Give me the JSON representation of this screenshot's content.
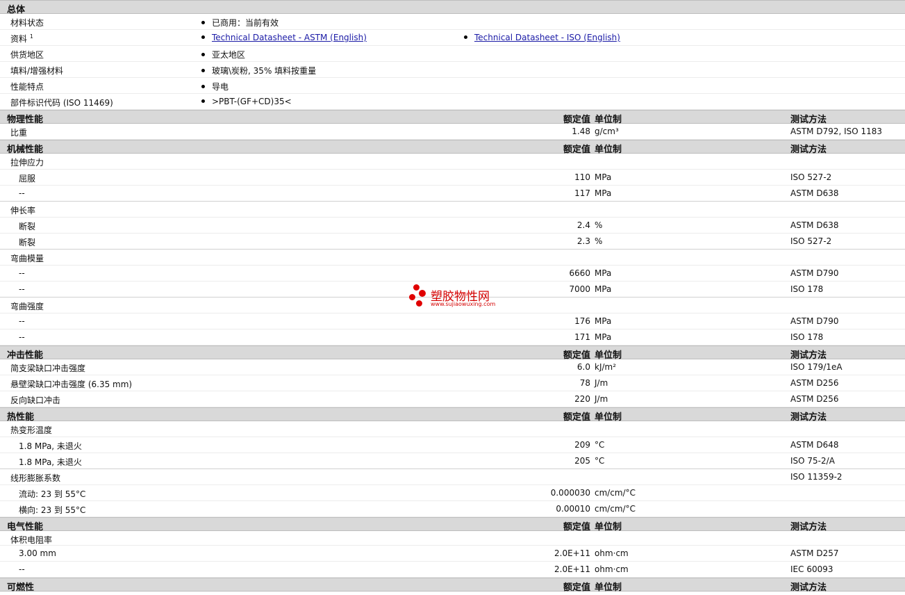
{
  "general": {
    "title": "总体",
    "rows": [
      {
        "label": "材料状态",
        "value": "已商用：当前有效"
      },
      {
        "label": "资料",
        "sup": "1",
        "link1": "Technical Datasheet - ASTM (English)",
        "link2": "Technical Datasheet - ISO (English)"
      },
      {
        "label": "供货地区",
        "value": "亚太地区"
      },
      {
        "label": "填料/增强材料",
        "value": "玻璃\\炭粉, 35% 填料按重量"
      },
      {
        "label": "性能特点",
        "value": "导电"
      },
      {
        "label": "部件标识代码 (ISO 11469)",
        "value": ">PBT-(GF+CD)35<"
      }
    ]
  },
  "headers": {
    "nominal": "额定值",
    "unit": "单位制",
    "method": "测试方法"
  },
  "physical": {
    "title": "物理性能",
    "rows": [
      {
        "label": "比重",
        "value": "1.48",
        "unit": "g/cm³",
        "method": "ASTM D792, ISO 1183"
      }
    ]
  },
  "mechanical": {
    "title": "机械性能",
    "tensile": {
      "label": "拉伸应力",
      "r1": {
        "label": "屈服",
        "value": "110",
        "unit": "MPa",
        "method": "ISO 527-2"
      },
      "r2": {
        "label": "--",
        "value": "117",
        "unit": "MPa",
        "method": "ASTM D638"
      }
    },
    "elong": {
      "label": "伸长率",
      "r1": {
        "label": "断裂",
        "value": "2.4",
        "unit": "%",
        "method": "ASTM D638"
      },
      "r2": {
        "label": "断裂",
        "value": "2.3",
        "unit": "%",
        "method": "ISO 527-2"
      }
    },
    "flexmod": {
      "label": "弯曲模量",
      "r1": {
        "label": "--",
        "value": "6660",
        "unit": "MPa",
        "method": "ASTM D790"
      },
      "r2": {
        "label": "--",
        "value": "7000",
        "unit": "MPa",
        "method": "ISO 178"
      }
    },
    "flexstr": {
      "label": "弯曲强度",
      "r1": {
        "label": "--",
        "value": "176",
        "unit": "MPa",
        "method": "ASTM D790"
      },
      "r2": {
        "label": "--",
        "value": "171",
        "unit": "MPa",
        "method": "ISO 178"
      }
    }
  },
  "impact": {
    "title": "冲击性能",
    "r1": {
      "label": "简支梁缺口冲击强度",
      "value": "6.0",
      "unit": "kJ/m²",
      "method": "ISO 179/1eA"
    },
    "r2": {
      "label": "悬壁梁缺口冲击强度 (6.35 mm)",
      "value": "78",
      "unit": "J/m",
      "method": "ASTM D256"
    },
    "r3": {
      "label": "反向缺口冲击",
      "value": "220",
      "unit": "J/m",
      "method": "ASTM D256"
    }
  },
  "thermal": {
    "title": "热性能",
    "hdt": {
      "label": "热变形温度",
      "r1": {
        "label": "1.8 MPa, 未退火",
        "value": "209",
        "unit": "°C",
        "method": "ASTM D648"
      },
      "r2": {
        "label": "1.8 MPa, 未退火",
        "value": "205",
        "unit": "°C",
        "method": "ISO 75-2/A"
      }
    },
    "clte": {
      "label": "线形膨胀系数",
      "method": "ISO 11359-2",
      "r1": {
        "label": "流动: 23 到  55°C",
        "value": "0.000030",
        "unit": "cm/cm/°C"
      },
      "r2": {
        "label": "横向: 23 到  55°C",
        "value": "0.00010",
        "unit": "cm/cm/°C"
      }
    }
  },
  "electrical": {
    "title": "电气性能",
    "vr": {
      "label": "体积电阻率",
      "r1": {
        "label": "3.00 mm",
        "value": "2.0E+11",
        "unit": "ohm·cm",
        "method": "ASTM D257"
      },
      "r2": {
        "label": "--",
        "value": "2.0E+11",
        "unit": "ohm·cm",
        "method": "IEC 60093"
      }
    }
  },
  "flammability": {
    "title": "可燃性"
  },
  "watermark": {
    "name": "塑胶物性网",
    "url": "www.sujiaowuxing.com"
  }
}
